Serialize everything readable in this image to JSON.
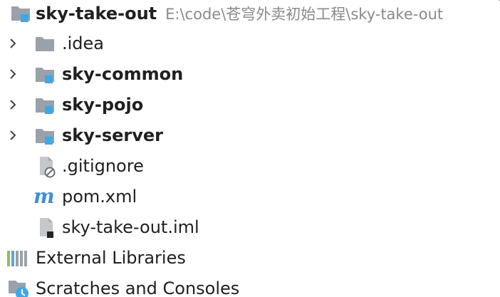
{
  "project_tree": {
    "root": {
      "label": "sky-take-out",
      "path": "E:\\code\\苍穹外卖初始工程\\sky-take-out",
      "icon": "module-folder-icon"
    },
    "items": [
      {
        "label": ".idea",
        "icon": "folder-icon",
        "expandable": true,
        "bold": false
      },
      {
        "label": "sky-common",
        "icon": "module-folder-icon",
        "expandable": true,
        "bold": true
      },
      {
        "label": "sky-pojo",
        "icon": "module-folder-icon",
        "expandable": true,
        "bold": true
      },
      {
        "label": "sky-server",
        "icon": "module-folder-icon",
        "expandable": true,
        "bold": true
      },
      {
        "label": ".gitignore",
        "icon": "ignored-file-icon",
        "expandable": false,
        "bold": false
      },
      {
        "label": "pom.xml",
        "icon": "maven-icon",
        "expandable": false,
        "bold": false
      },
      {
        "label": "sky-take-out.iml",
        "icon": "iml-file-icon",
        "expandable": false,
        "bold": false
      }
    ],
    "external_libraries": {
      "label": "External Libraries",
      "icon": "libraries-icon"
    },
    "scratches": {
      "label": "Scratches and Consoles",
      "icon": "scratches-icon"
    }
  },
  "colors": {
    "folder_gray": "#9aa1a8",
    "module_blue": "#3ea7e8",
    "maven_blue": "#3d8fd6",
    "text": "#202020",
    "path_gray": "#8a8a8a"
  }
}
